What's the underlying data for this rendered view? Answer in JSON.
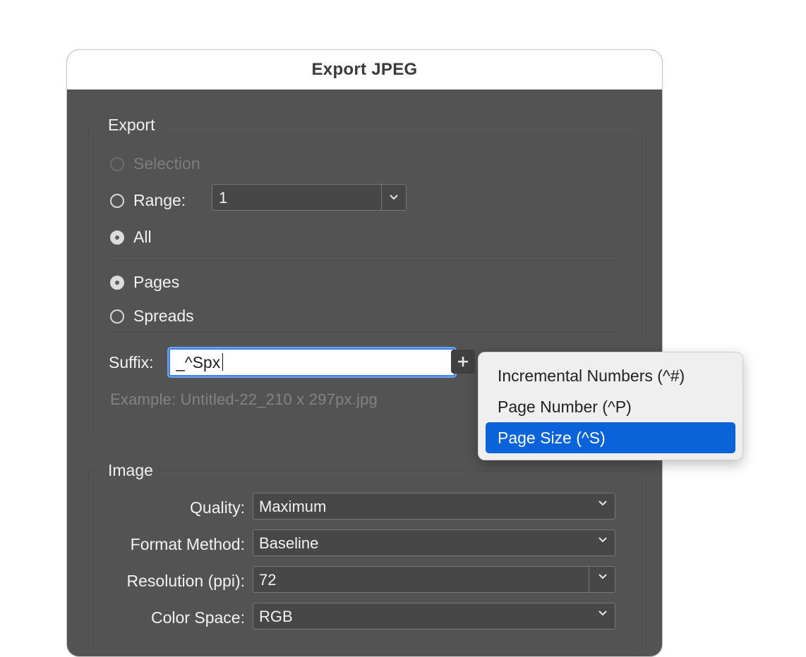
{
  "dialog": {
    "title": "Export JPEG"
  },
  "export": {
    "legend": "Export",
    "selection_label": "Selection",
    "range_label": "Range:",
    "range_value": "1",
    "all_label": "All",
    "pages_label": "Pages",
    "spreads_label": "Spreads",
    "suffix_label": "Suffix:",
    "suffix_value": "_^Spx",
    "example_text": "Example: Untitled-22_210 x 297px.jpg"
  },
  "image": {
    "legend": "Image",
    "quality_label": "Quality:",
    "quality_value": "Maximum",
    "format_label": "Format Method:",
    "format_value": "Baseline",
    "resolution_label": "Resolution (ppi):",
    "resolution_value": "72",
    "colorspace_label": "Color Space:",
    "colorspace_value": "RGB"
  },
  "popup_menu": {
    "items": [
      "Incremental Numbers (^#)",
      "Page Number (^P)",
      "Page Size (^S)"
    ],
    "selected": "Page Size (^S)"
  },
  "colors": {
    "accent": "#0a63d8",
    "dialog_bg": "#535353",
    "focus_ring": "#3f7fe0"
  }
}
